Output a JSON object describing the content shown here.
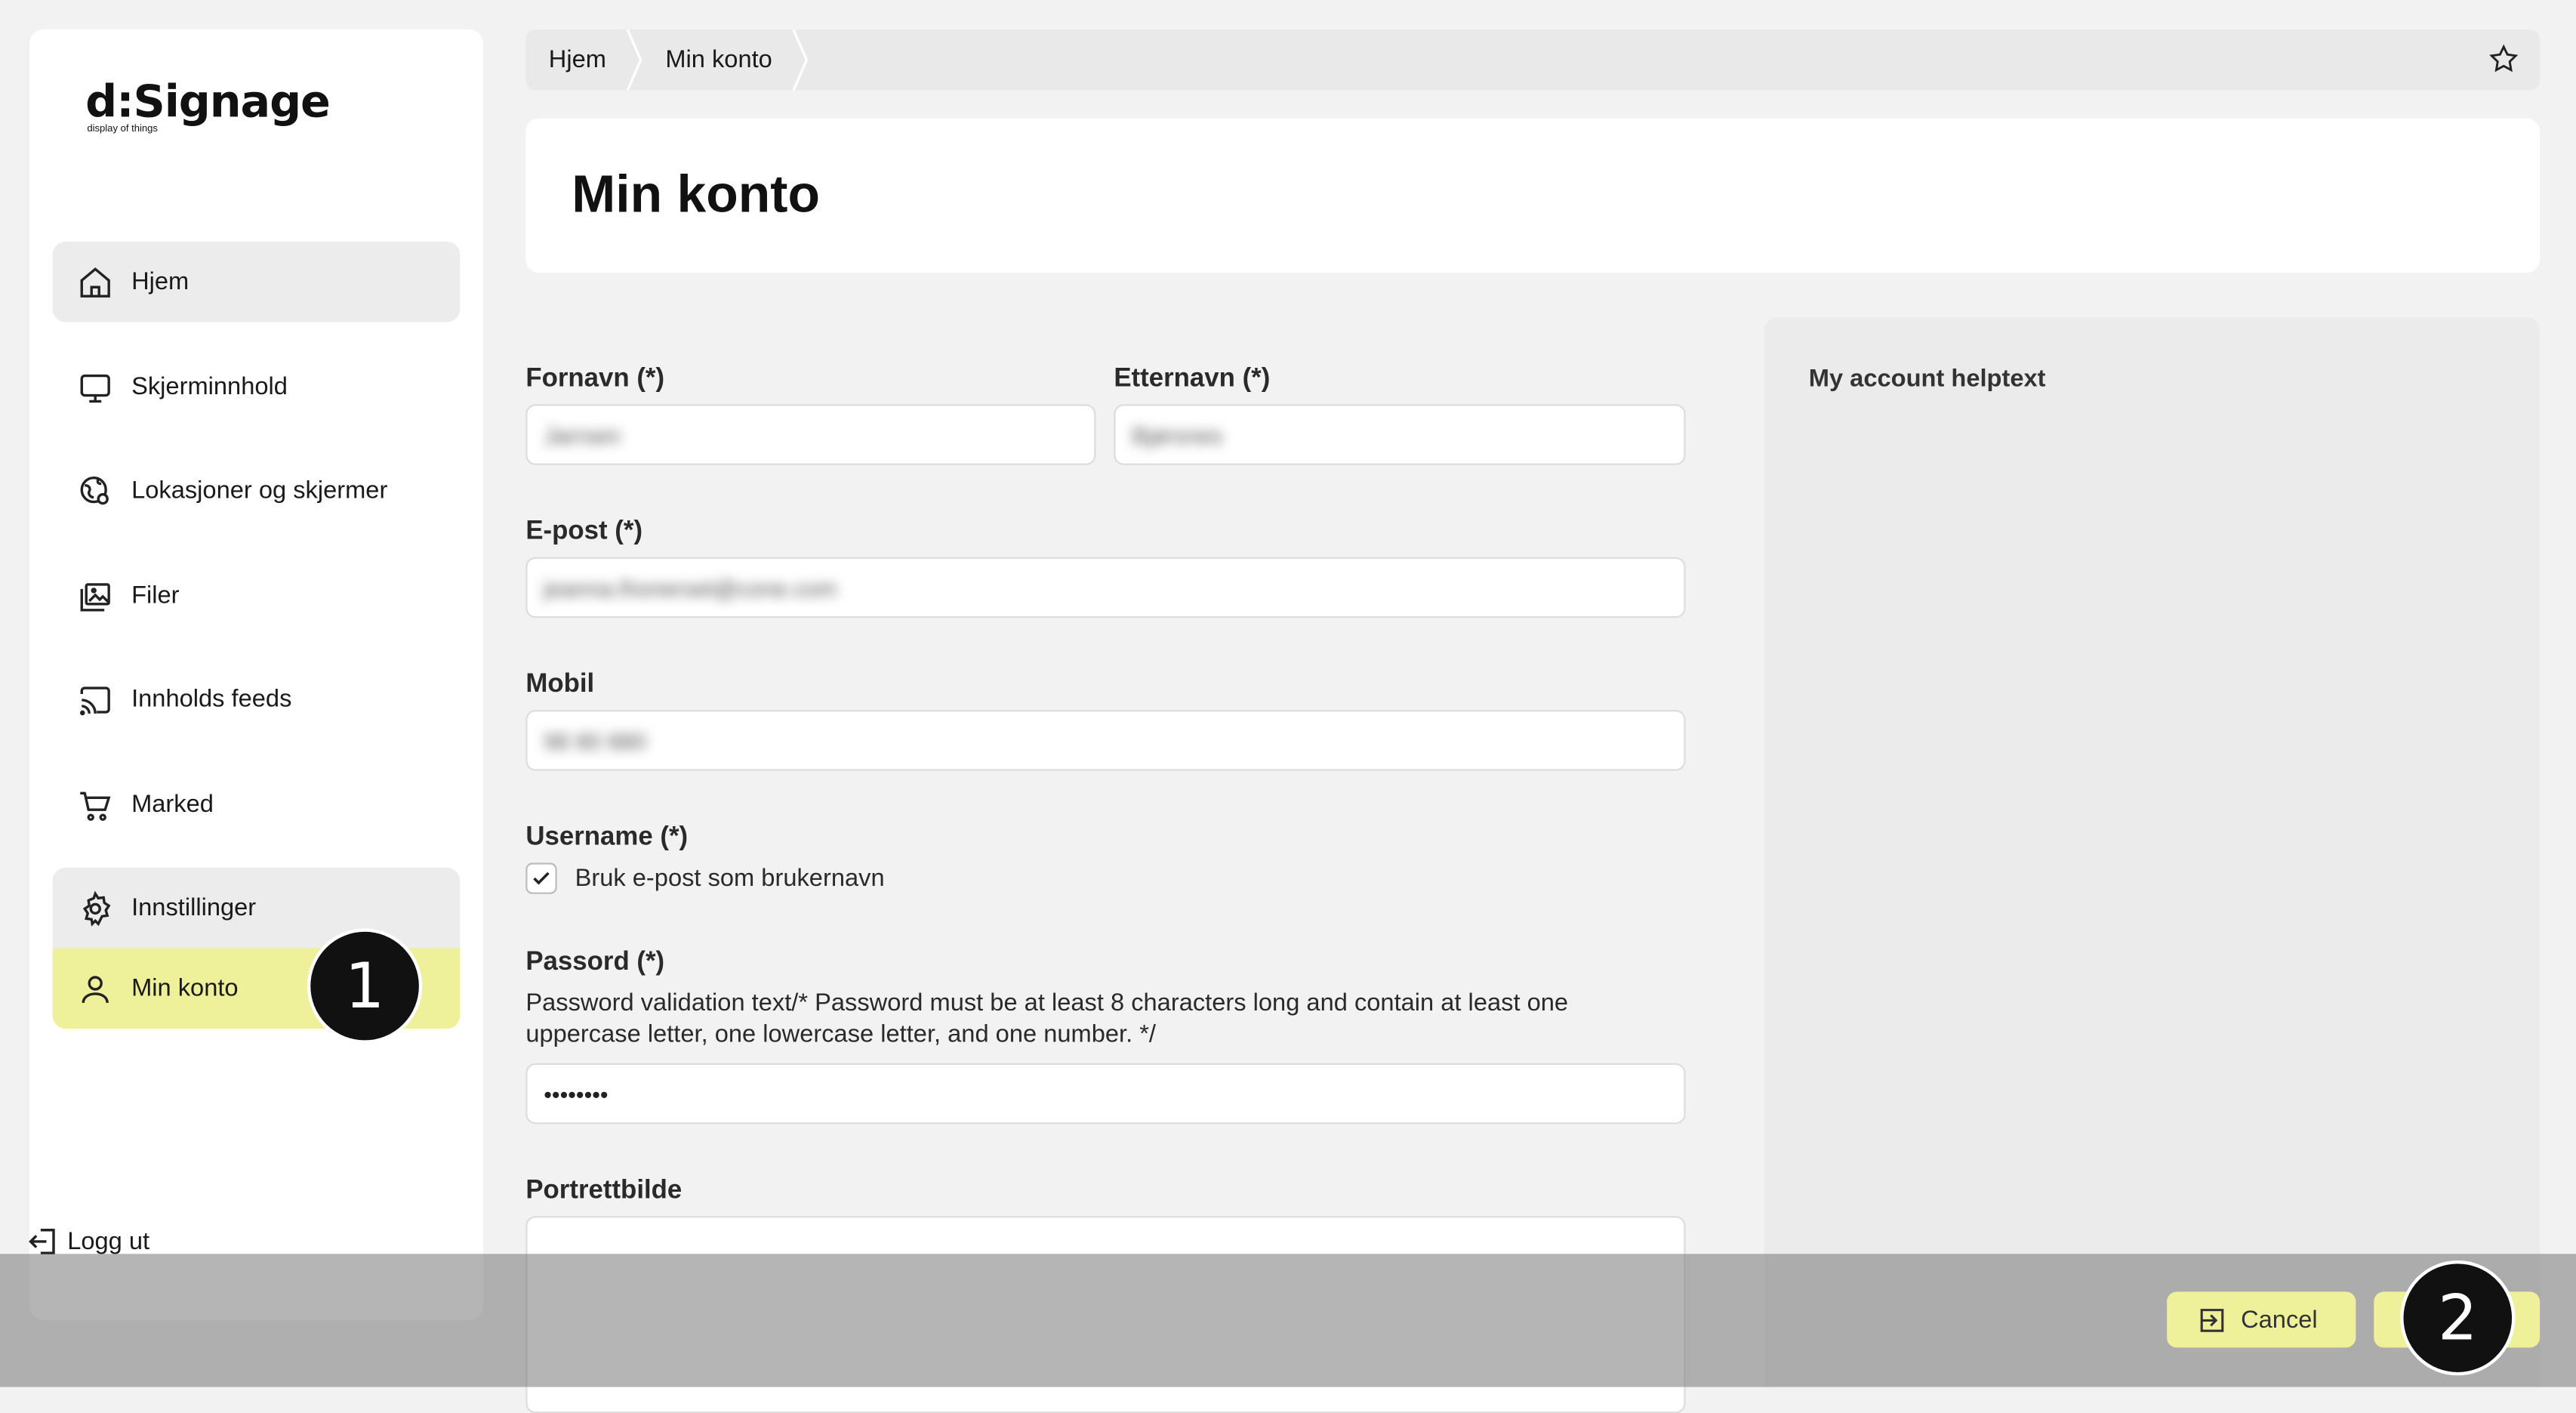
{
  "brand": {
    "name": "d:Signage",
    "tagline": "display of things"
  },
  "sidebar": {
    "items": [
      {
        "label": "Hjem",
        "icon": "home-icon"
      },
      {
        "label": "Skjerminnhold",
        "icon": "monitor-icon"
      },
      {
        "label": "Lokasjoner og skjermer",
        "icon": "location-icon"
      },
      {
        "label": "Filer",
        "icon": "images-icon"
      },
      {
        "label": "Innholds feeds",
        "icon": "cast-icon"
      },
      {
        "label": "Marked",
        "icon": "cart-icon"
      },
      {
        "label": "Innstillinger",
        "icon": "gear-icon"
      },
      {
        "label": "Min konto",
        "icon": "user-icon"
      }
    ],
    "logout_label": "Logg ut"
  },
  "breadcrumb": {
    "items": [
      "Hjem",
      "Min konto"
    ]
  },
  "page": {
    "title": "Min konto"
  },
  "help": {
    "text": "My account helptext"
  },
  "form": {
    "first_name": {
      "label": "Fornavn (*)",
      "value": "Jarrsen"
    },
    "last_name": {
      "label": "Etternavn (*)",
      "value": "Bjørsnes"
    },
    "email": {
      "label": "E-post (*)",
      "value": "jeanna.lhonerset@cone.com"
    },
    "mobile": {
      "label": "Mobil",
      "value": "98 80 880"
    },
    "username": {
      "label": "Username (*)",
      "checkbox_label": "Bruk e-post som brukernavn",
      "checked": true
    },
    "password": {
      "label": "Passord (*)",
      "hint": "Password validation text/* Password must be at least 8 characters long and contain at least one uppercase letter, one lowercase letter, and one number. */",
      "value": "••••••••"
    },
    "portrait": {
      "label": "Portrettbilde"
    }
  },
  "actions": {
    "cancel_label": "Cancel"
  },
  "markers": {
    "one": "1",
    "two": "2"
  },
  "colors": {
    "accent": "#eef19a",
    "background": "#f2f2f2"
  }
}
